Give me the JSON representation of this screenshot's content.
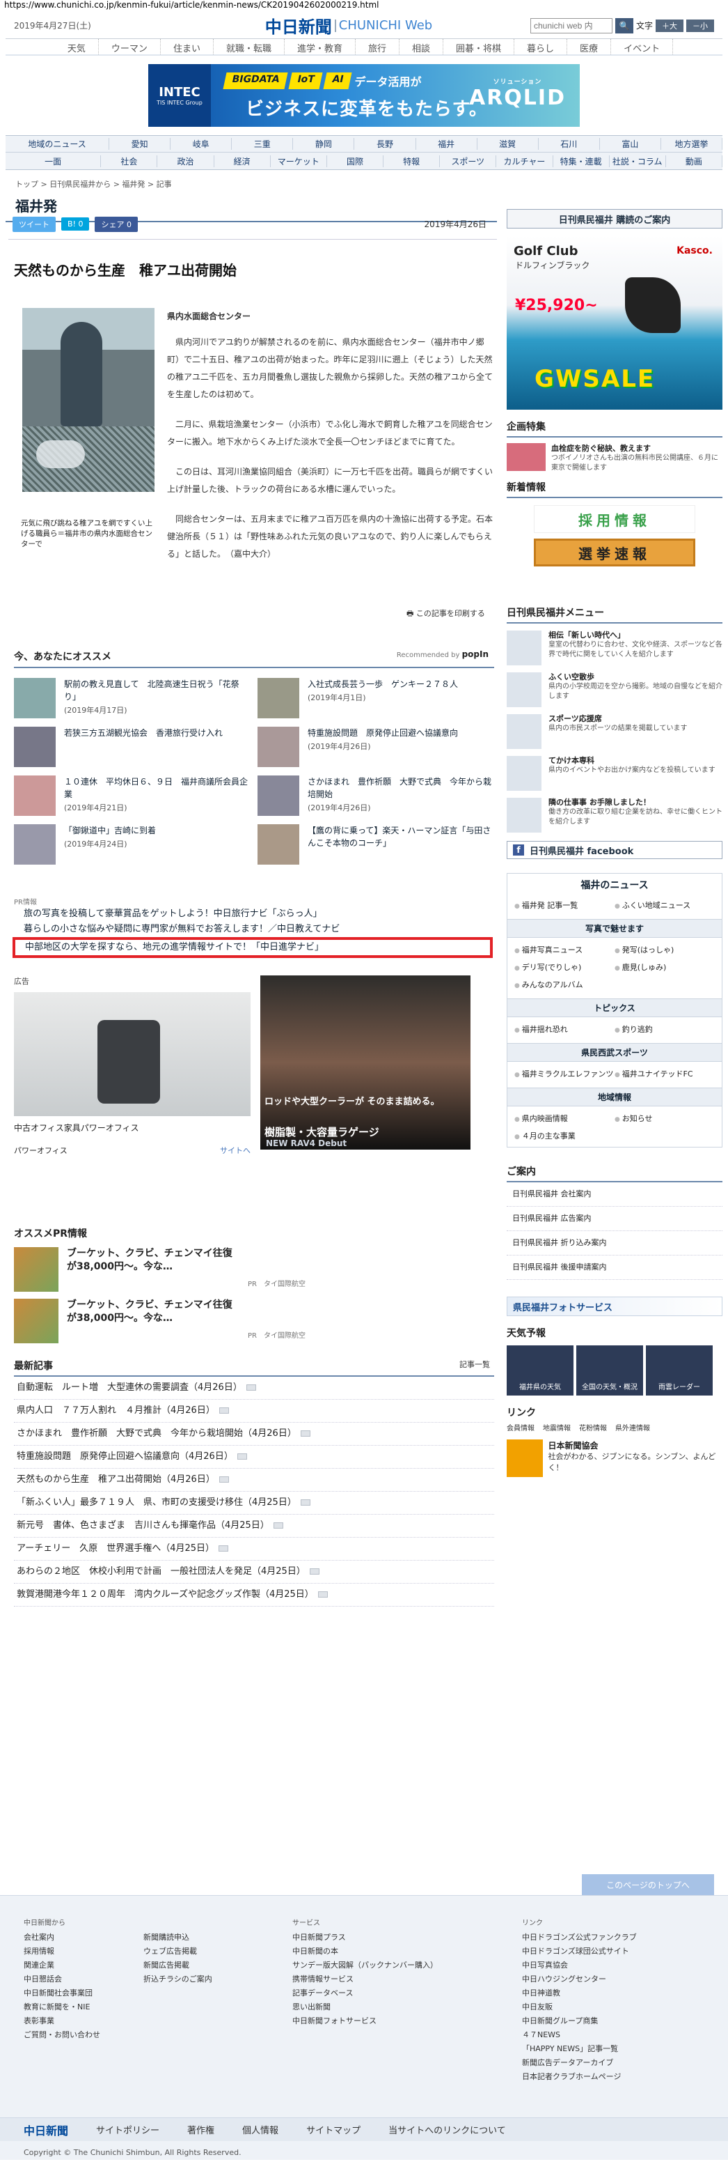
{
  "url": "https://www.chunichi.co.jp/kenmin-fukui/article/kenmin-news/CK2019042602000219.html",
  "header": {
    "date": "2019年4月27日(土)",
    "logo_jp": "中日新聞",
    "logo_en": "CHUNICHI Web",
    "search_placeholder": "chunichi web 内",
    "search_btn": "🔍",
    "font_label": "文字",
    "font_plus": "＋大",
    "font_minus": "－小"
  },
  "gnav": [
    "天気",
    "ウーマン",
    "住まい",
    "就職・転職",
    "進学・教育",
    "旅行",
    "相談",
    "囲碁・将棋",
    "暮らし",
    "医療",
    "イベント"
  ],
  "banner": {
    "left": "INTEC",
    "left_sub": "TIS INTEC Group",
    "tags": [
      "BIGDATA",
      "IoT",
      "AI"
    ],
    "tag_tail": "データ活用が",
    "big": "ビジネスに変革をもたらす。",
    "right": "ARQLID",
    "right_sub": "ソリューション"
  },
  "nav2": {
    "row1": [
      "地域のニュース",
      "愛知",
      "岐阜",
      "三重",
      "静岡",
      "長野",
      "福井",
      "滋賀",
      "石川",
      "富山",
      "地方選挙"
    ],
    "row2": [
      "一面",
      "社会",
      "政治",
      "経済",
      "マーケット",
      "国際",
      "特報",
      "スポーツ",
      "カルチャー",
      "特集・連載",
      "社説・コラム",
      "動画"
    ]
  },
  "breadcrumb": "トップ > 日刊県民福井から > 福井発 > 記事",
  "section_title": "福井発",
  "social": {
    "tweet": "ツイート",
    "hatena": "B! 0",
    "fb": "シェア 0",
    "date": "2019年4月26日"
  },
  "headline": "天然ものから生産　稚アユ出荷開始",
  "caption": "元気に飛び跳ねる稚アユを網ですくい上げる職員ら＝福井市の県内水面総合センターで",
  "body": {
    "src": "県内水面総合センター",
    "p1": "県内河川でアユ釣りが解禁されるのを前に、県内水面総合センター（福井市中ノ郷町）で二十五日、稚アユの出荷が始まった。昨年に足羽川に遡上（そじょう）した天然の稚アユ二千匹を、五カ月間養魚し選抜した親魚から採卵した。天然の稚アユから全てを生産したのは初めて。",
    "p2": "二月に、県栽培漁業センター（小浜市）でふ化し海水で飼育した稚アユを同総合センターに搬入。地下水からくみ上げた淡水で全長一〇センチほどまでに育てた。",
    "p3": "この日は、耳河川漁業協同組合（美浜町）に一万七千匹を出荷。職員らが網ですくい上げ計量した後、トラックの荷台にある水槽に運んでいった。",
    "p4": "同総合センターは、五月末までに稚アユ百万匹を県内の十漁協に出荷する予定。石本健治所長（５１）は「野性味あふれた元気の良いアユなので、釣り人に楽しんでもらえる」と話した。　（嘉中大介）"
  },
  "print": "この記事を印刷する",
  "recommend": {
    "title": "今、あなたにオススメ",
    "by": "Recommended by",
    "brand": "popIn",
    "items": [
      {
        "t": "駅前の教え見直して　北陸高速生日祝う「花祭り」",
        "d": "(2019年4月17日)"
      },
      {
        "t": "入社式成長芸う一歩　ゲンキー２７８人",
        "d": "(2019年4月1日)"
      },
      {
        "t": "若狭三方五湖観光協会　香港旅行受け入れ",
        "d": ""
      },
      {
        "t": "特重施設問題　原発停止回避へ協議意向",
        "d": "(2019年4月26日)"
      },
      {
        "t": "１０連休　平均休日６、９日　福井商議所会員企業",
        "d": "(2019年4月21日)"
      },
      {
        "t": "さかほまれ　豊作祈願　大野で式典　今年から栽培開始",
        "d": "(2019年4月26日)"
      },
      {
        "t": "「御鍬道中」吉崎に到着",
        "d": "(2019年4月24日)"
      },
      {
        "t": "【鷹の背に乗って】楽天・ハーマン証言「与田さんこそ本物のコーチ」",
        "d": ""
      }
    ]
  },
  "pr": {
    "label": "PR情報",
    "items": [
      "旅の写真を投稿して豪華賞品をゲットしよう！中日旅行ナビ「ぶらっ人」",
      "暮らしの小さな悩みや疑問に専門家が無料でお答えします！／中日教えてナビ",
      "中部地区の大学を探すなら、地元の進学情報サイトで！「中日進学ナビ」"
    ]
  },
  "ad1": {
    "label": "広告",
    "name": "中古オフィス家具パワーオフィス",
    "brand": "パワーオフィス",
    "link": "サイトへ"
  },
  "ad2": {
    "t1": "ロッドや大型クーラーが\nそのまま詰める。",
    "t2": "樹脂製・大容量ラゲージ",
    "t3": "NEW RAV4 Debut"
  },
  "ospr": {
    "title": "オススメPR情報",
    "items": [
      {
        "t": "ブーケット、クラビ、チェンマイ往復",
        "p": "が38,000円～。今な…",
        "s": "PR　タイ国際航空"
      },
      {
        "t": "ブーケット、クラビ、チェンマイ往復",
        "p": "が38,000円～。今な…",
        "s": "PR　タイ国際航空"
      }
    ]
  },
  "latest": {
    "title": "最新記事",
    "more": "記事一覧",
    "items": [
      "自動運転　ルート増　大型連休の需要調査（4月26日）",
      "県内人口　７７万人割れ　４月推計（4月26日）",
      "さかほまれ　豊作祈願　大野で式典　今年から栽培開始（4月26日）",
      "特重施設問題　原発停止回避へ協議意向（4月26日）",
      "天然ものから生産　稚アユ出荷開始（4月26日）",
      "「新ふくい人」最多７１９人　県、市町の支援受け移住（4月25日）",
      "新元号　書体、色さまざま　吉川さんも揮毫作品（4月25日）",
      "アーチェリー　久原　世界選手権へ（4月25日）",
      "あわらの２地区　休校小利用で計画　一般社団法人を発足（4月25日）",
      "敦賀港開港今年１２０周年　湾内クルーズや記念グッズ作製（4月25日）"
    ]
  },
  "side": {
    "kodoku": "日刊県民福井 購読のご案内",
    "golf": {
      "g1": "Golf Club",
      "g2": "ドルフィンブラック",
      "g3": "Kasco.",
      "g4": "¥25,920~",
      "g5": "GWSALE"
    },
    "kikaku": {
      "title": "企画特集",
      "t": "血栓症を防ぐ秘訣、教えます",
      "s": "つボイノリオさんも出演の無料市民公開講座、６月に東京で開催します"
    },
    "shinchaku": "新着情報",
    "bn1": "採用情報",
    "bn2": "選挙速報",
    "fmenu": {
      "title": "日刊県民福井メニュー",
      "items": [
        {
          "t": "相伝「新しい時代へ」",
          "s": "皇室の代替わりに合わせ、文化や経済、スポーツなど各界で時代に関をしていく人を紹介します"
        },
        {
          "t": "ふくい空散歩",
          "s": "県内の小学校周辺を空から撮影。地域の自慢などを紹介します"
        },
        {
          "t": "スポーツ応援席",
          "s": "県内の市民スポーツの結果を掲載しています"
        },
        {
          "t": "てかけ本専科",
          "s": "県内のイベントやお出かけ案内などを投稿しています"
        },
        {
          "t": "隣の仕事事 お手隙しました！",
          "s": "働き方の改革に取り組む企業を訪ね、幸せに働くヒントを紹介します"
        }
      ]
    },
    "fb": "日刊県民福井 facebook",
    "fnews": {
      "title": "福井のニュース",
      "a": [
        "福井発 記事一覧",
        "ふくい地域ニュース"
      ],
      "photo": "写真で魅せます",
      "b": [
        "福井写真ニュース",
        "発写(はっしゃ)",
        "デリ写(でりしゃ)",
        "鹿見(しゅみ)",
        "みんなのアルバム"
      ],
      "topics": "トピックス",
      "c": [
        "福井揺れ恐れ",
        "釣り逃釣"
      ],
      "sports": "県民西武スポーツ",
      "d": [
        "福井ミラクルエレファンツ",
        "福井ユナイテッドFC"
      ],
      "area": "地域情報",
      "e": [
        "県内映画情報",
        "お知らせ",
        "４月の主な事業"
      ]
    },
    "annai": {
      "title": "ご案内",
      "items": [
        "日刊県民福井 会社案内",
        "日刊県民福井 広告案内",
        "日刊県民福井 折り込み案内",
        "日刊県民福井 後援申請案内"
      ]
    },
    "photosvc": "県民福井フォトサービス",
    "tenki": {
      "title": "天気予報",
      "items": [
        "福井県の天気",
        "全国の天気・概況",
        "雨雲レーダー"
      ]
    },
    "link": {
      "title": "リンク",
      "items": [
        "会員情報",
        "地震情報",
        "花粉情報",
        "県外連情報"
      ]
    },
    "jnk": {
      "t": "日本新聞協会",
      "s": "社会がわかる、ジブンになる。シンブン、よんどく！"
    }
  },
  "totop": "このページのトップへ",
  "footer": {
    "c1h": "中日新聞から",
    "c1": [
      "会社案内",
      "採用情報",
      "関連企業",
      "中日懇話会",
      "中日新聞社会事業団",
      "教育に新聞を・NIE",
      "表彰事業",
      "ご質問・お問い合わせ"
    ],
    "c2": [
      "新聞購読申込",
      "ウェブ広告掲載",
      "新聞広告掲載",
      "折込チラシのご案内"
    ],
    "c3h": "サービス",
    "c3": [
      "中日新聞プラス",
      "中日新聞の本",
      "サンデー版大図解（パックナンバー購入）",
      "携帯情報サービス",
      "記事データベース",
      "思い出新聞",
      "中日新聞フォトサービス"
    ],
    "c4h": "リンク",
    "c4": [
      "中日ドラゴンズ公式ファンクラブ",
      "中日ドラゴンズ球団公式サイト",
      "中日写真協会",
      "中日ハウジングセンター",
      "中日神道教",
      "中日友販",
      "中日新聞グループ商集",
      "４７NEWS",
      "「HAPPY NEWS」記事一覧",
      "新聞広告データアーカイブ",
      "日本記者クラブホームページ"
    ],
    "bar": [
      "中日新聞",
      "サイトポリシー",
      "著作権",
      "個人情報",
      "サイトマップ",
      "当サイトへのリンクについて"
    ],
    "copy": "Copyright © The Chunichi Shimbun, All Rights Reserved."
  }
}
